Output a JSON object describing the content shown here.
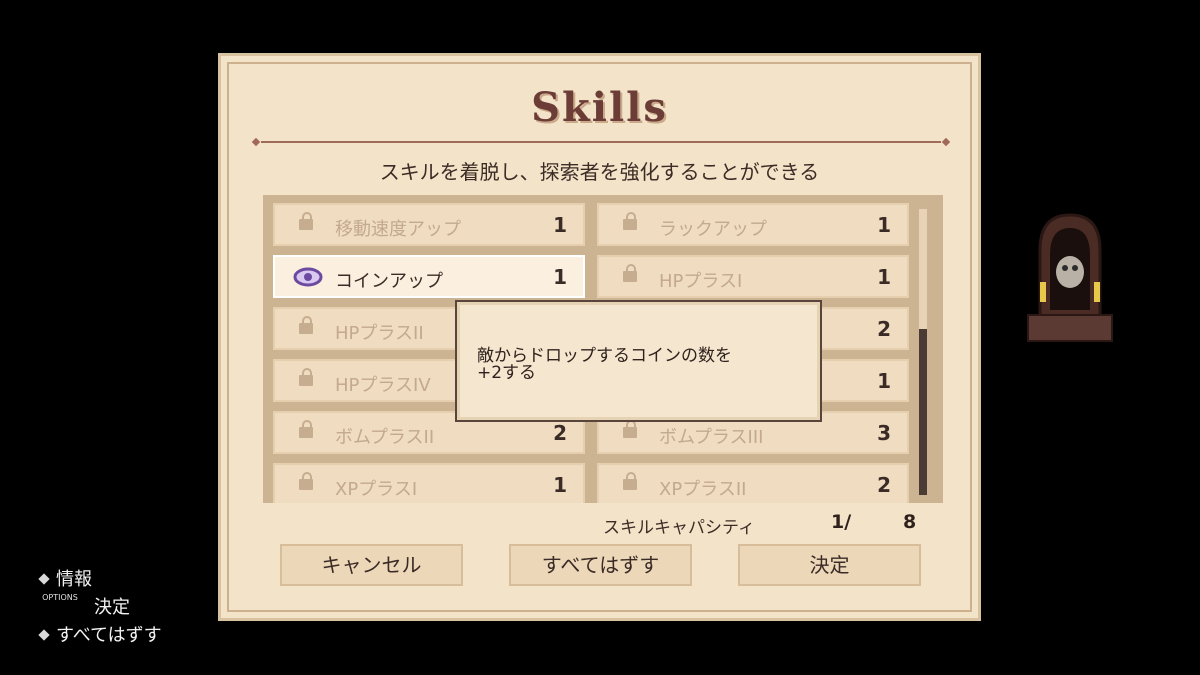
{
  "panel": {
    "title": "Skills",
    "subtitle": "スキルを着脱し、探索者を強化することができる"
  },
  "skills": [
    {
      "label": "移動速度アップ",
      "cost": "1",
      "state": "locked"
    },
    {
      "label": "ラックアップ",
      "cost": "1",
      "state": "locked"
    },
    {
      "label": "コインアップ",
      "cost": "1",
      "state": "selected"
    },
    {
      "label": "HPプラスI",
      "cost": "1",
      "state": "locked"
    },
    {
      "label": "HPプラスII",
      "cost": "",
      "state": "locked"
    },
    {
      "label": "",
      "cost": "2",
      "state": "locked"
    },
    {
      "label": "HPプラスIV",
      "cost": "",
      "state": "locked"
    },
    {
      "label": "",
      "cost": "1",
      "state": "locked"
    },
    {
      "label": "ボムプラスII",
      "cost": "2",
      "state": "locked"
    },
    {
      "label": "ボムプラスIII",
      "cost": "3",
      "state": "locked"
    },
    {
      "label": "XPプラスI",
      "cost": "1",
      "state": "locked"
    },
    {
      "label": "XPプラスII",
      "cost": "2",
      "state": "locked"
    }
  ],
  "tooltip": {
    "text": "敵からドロップするコインの数を\n+2する"
  },
  "capacity": {
    "label": "スキルキャパシティ",
    "used": "1/",
    "max": "8"
  },
  "buttons": {
    "cancel": "キャンセル",
    "unequip_all": "すべてはずす",
    "confirm": "決定"
  },
  "hints": [
    {
      "icon": "diamond-button-icon",
      "label": "情報"
    },
    {
      "icon": "options-button-icon",
      "tag": "OPTIONS",
      "label": "決定"
    },
    {
      "icon": "diamond-button-icon",
      "label": "すべてはずす"
    }
  ],
  "colors": {
    "panel_bg": "#f3e3c9",
    "title": "#6b3d36",
    "selected_border": "#ffffff",
    "eye_icon": "#6b4aa0"
  }
}
